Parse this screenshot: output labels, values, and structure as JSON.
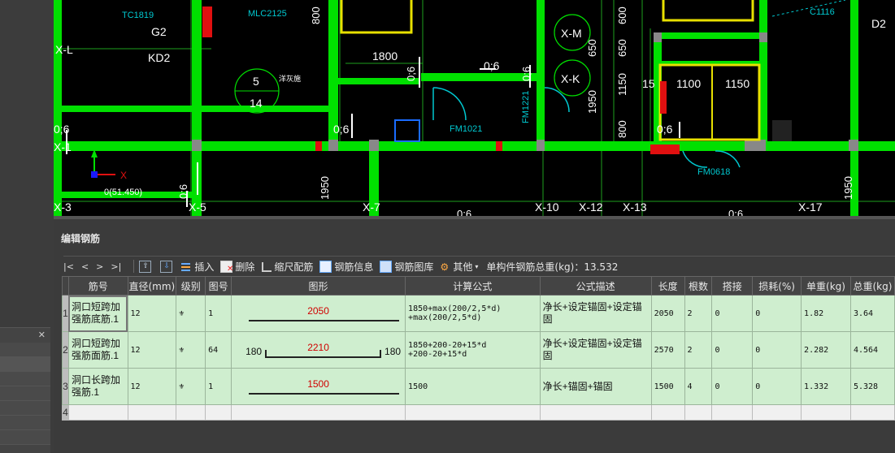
{
  "cad": {
    "texts": [
      "TC1819",
      "G2",
      "KD2",
      "MLC2125",
      "X-L",
      "5",
      "14",
      "洋灰施",
      "1800",
      "0;6",
      "0;6",
      "0;6",
      "0;6",
      "X-M",
      "X-K",
      "650",
      "650",
      "600",
      "1950",
      "1150",
      "1100",
      "1150",
      "FM1021",
      "FM1221",
      "FM0618",
      "C1116",
      "D2",
      "0(51.450)",
      "X-5",
      "X-7",
      "X-10",
      "X-12",
      "X-13",
      "X-17",
      "1950",
      "1950",
      "0;6",
      "0;6",
      "800",
      "800",
      "X-3"
    ]
  },
  "panel": {
    "title": "编辑钢筋",
    "toolbar": {
      "nav": [
        "|<",
        "<",
        ">",
        ">|"
      ],
      "insert": "插入",
      "delete": "删除",
      "scale": "缩尺配筋",
      "info": "钢筋信息",
      "library": "钢筋图库",
      "other": "其他",
      "total_label": "单构件钢筋总重(kg)：13.532"
    },
    "columns": [
      "筋号",
      "直径(mm)",
      "级别",
      "图号",
      "图形",
      "计算公式",
      "公式描述",
      "长度",
      "根数",
      "搭接",
      "损耗(%)",
      "单重(kg)",
      "总重(kg)"
    ],
    "rows": [
      {
        "num": "1",
        "name": "洞口短跨加强筋底筋.1",
        "dia": "12",
        "grade": "⚜",
        "fig": "1",
        "shape_mid": "2050",
        "shape_left": "",
        "shape_right": "",
        "formula1": "1850+max(200/2,5*d)",
        "formula2": "+max(200/2,5*d)",
        "desc": "净长+设定锚固+设定锚固",
        "len": "2050",
        "count": "2",
        "lap": "0",
        "loss": "0",
        "unit": "1.82",
        "total": "3.64"
      },
      {
        "num": "2",
        "name": "洞口短跨加强筋面筋.1",
        "dia": "12",
        "grade": "⚜",
        "fig": "64",
        "shape_mid": "2210",
        "shape_left": "180",
        "shape_right": "180",
        "formula1": "1850+200-20+15*d",
        "formula2": "+200-20+15*d",
        "desc": "净长+设定锚固+设定锚固",
        "len": "2570",
        "count": "2",
        "lap": "0",
        "loss": "0",
        "unit": "2.282",
        "total": "4.564"
      },
      {
        "num": "3",
        "name": "洞口长跨加强筋.1",
        "dia": "12",
        "grade": "⚜",
        "fig": "1",
        "shape_mid": "1500",
        "shape_left": "",
        "shape_right": "",
        "formula1": "1500",
        "formula2": "",
        "desc": "净长+锚固+锚固",
        "len": "1500",
        "count": "4",
        "lap": "0",
        "loss": "0",
        "unit": "1.332",
        "total": "5.328"
      }
    ],
    "empty_row_num": "4"
  },
  "colors": {
    "wall": "#00e000",
    "grid": "#1ea01e",
    "cad_bg": "#000000",
    "row_bg": "#cfeecf",
    "accent_red": "#d00000",
    "label_cyan": "#00c8d0"
  }
}
